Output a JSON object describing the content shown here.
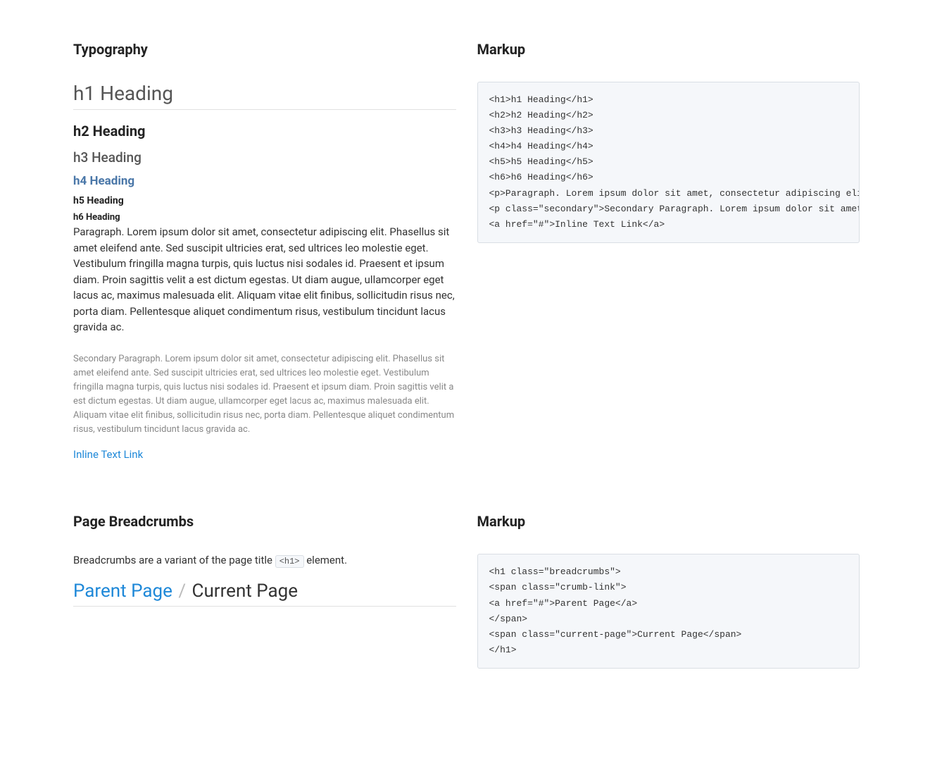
{
  "typography": {
    "section_title": "Typography",
    "markup_title": "Markup",
    "h1": "h1 Heading",
    "h2": "h2 Heading",
    "h3": "h3 Heading",
    "h4": "h4 Heading",
    "h5": "h5 Heading",
    "h6": "h6 Heading",
    "p_primary": "Paragraph. Lorem ipsum dolor sit amet, consectetur adipiscing elit. Phasellus sit amet eleifend ante. Sed suscipit ultricies erat, sed ultrices leo molestie eget. Vestibulum fringilla magna turpis, quis luctus nisi sodales id. Praesent et ipsum diam. Proin sagittis velit a est dictum egestas. Ut diam augue, ullamcorper eget lacus ac, maximus malesuada elit. Aliquam vitae elit finibus, sollicitudin risus nec, porta diam. Pellentesque aliquet condimentum risus, vestibulum tincidunt lacus gravida ac.",
    "p_secondary": "Secondary Paragraph. Lorem ipsum dolor sit amet, consectetur adipiscing elit. Phasellus sit amet eleifend ante. Sed suscipit ultricies erat, sed ultrices leo molestie eget. Vestibulum fringilla magna turpis, quis luctus nisi sodales id. Praesent et ipsum diam. Proin sagittis velit a est dictum egestas. Ut diam augue, ullamcorper eget lacus ac, maximus malesuada elit. Aliquam vitae elit finibus, sollicitudin risus nec, porta diam. Pellentesque aliquet condimentum risus, vestibulum tincidunt lacus gravida ac.",
    "link_text": "Inline Text Link",
    "code": "<h1>h1 Heading</h1>\n<h2>h2 Heading</h2>\n<h3>h3 Heading</h3>\n<h4>h4 Heading</h4>\n<h5>h5 Heading</h5>\n<h6>h6 Heading</h6>\n<p>Paragraph. Lorem ipsum dolor sit amet, consectetur adipiscing elit. Ph\n<p class=\"secondary\">Secondary Paragraph. Lorem ipsum dolor sit amet, con\n<a href=\"#\">Inline Text Link</a>"
  },
  "breadcrumbs": {
    "section_title": "Page Breadcrumbs",
    "markup_title": "Markup",
    "desc_pre": "Breadcrumbs are a variant of the page title ",
    "desc_code": "<h1>",
    "desc_post": " element.",
    "parent": "Parent Page",
    "sep": "/",
    "current": "Current Page",
    "code": "<h1 class=\"breadcrumbs\">\n<span class=\"crumb-link\">\n<a href=\"#\">Parent Page</a>\n</span>\n<span class=\"current-page\">Current Page</span>\n</h1>"
  }
}
